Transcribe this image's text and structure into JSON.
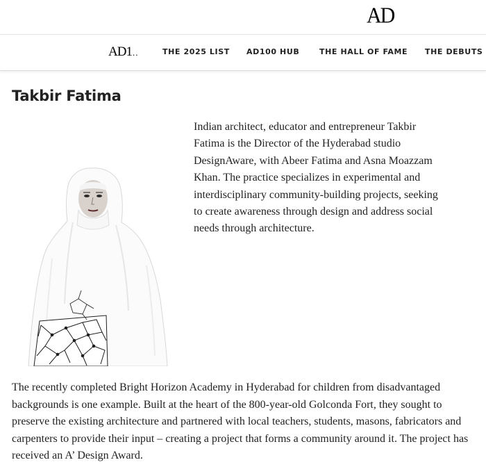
{
  "brand": {
    "logo": "AD"
  },
  "nav": {
    "logo": "AD1",
    "logo_dots": "..",
    "items": [
      "THE 2025 LIST",
      "AD100 HUB",
      "THE HALL OF FAME",
      "THE DEBUTS"
    ]
  },
  "article": {
    "title": "Takbir Fatima",
    "bio": "Indian architect, educator and entrepreneur Takbir Fatima is the Director of the Hyderabad studio DesignAware, with Abeer Fatima and Asna Moazzam Khan. The practice specializes in experimental and interdisciplinary community-building projects, seeking to create awareness through design and address social needs through architecture.",
    "paragraph": "The recently completed Bright Horizon Academy in Hyderabad for children from disadvantaged backgrounds is one example. Built at the heart of the 800-year-old Golconda Fort, they sought to preserve the existing architecture and partnered with local teachers, students, masons, fabricators and carpenters to provide their input – creating a project that forms a community around it. The project has received an A’ Design Award."
  }
}
